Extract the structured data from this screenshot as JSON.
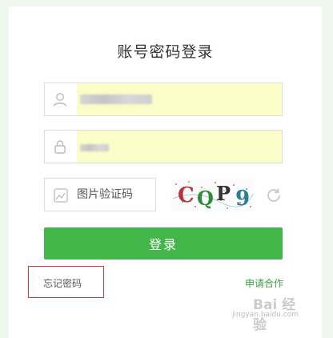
{
  "title": "账号密码登录",
  "username": {
    "icon": "user-icon"
  },
  "password": {
    "icon": "lock-icon"
  },
  "captcha": {
    "icon": "image-icon",
    "placeholder": "图片验证码",
    "code": [
      "C",
      "Q",
      "P",
      "9"
    ],
    "code_colors": [
      "#b8323b",
      "#2f8c3e",
      "#333333",
      "#2d7f8f"
    ],
    "refresh_icon": "refresh-icon"
  },
  "login_button": "登录",
  "forgot_password": "忘记密码",
  "apply_cooperation": "申请合作",
  "colors": {
    "primary_green": "#44b549",
    "link_green": "#3f9e45",
    "highlight_red": "#d33b3b",
    "autofill_yellow": "#fafdc7"
  },
  "watermark": {
    "text": "Bai 经验",
    "url": "jingyan.baidu.com"
  }
}
